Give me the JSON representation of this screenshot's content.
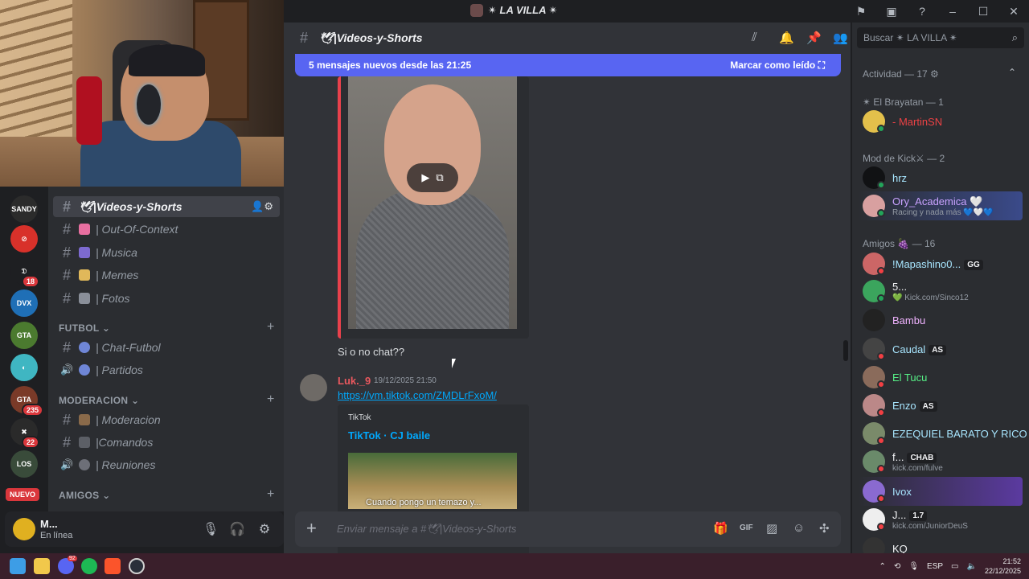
{
  "titlebar": {
    "server_name": "✴ LA VILLA ✴",
    "icons": [
      "inbox-flag-icon",
      "screen-icon",
      "help-icon",
      "minimize-icon",
      "maximize-icon",
      "close-icon"
    ],
    "btn_minimize": "–",
    "btn_maximize": "☐",
    "btn_close": "✕",
    "btn_flag": "⚑",
    "btn_help": "?"
  },
  "servers": [
    {
      "label": "SANDY",
      "color": "#2b2b2b",
      "badge": ""
    },
    {
      "label": "⊘",
      "color": "#d8312a",
      "badge": ""
    },
    {
      "label": "𝔇",
      "color": "#1e1f22",
      "badge": "18"
    },
    {
      "label": "DVX",
      "color": "#1f6fb6",
      "badge": ""
    },
    {
      "label": "GTA",
      "color": "#4b7a2f",
      "badge": ""
    },
    {
      "label": "◐",
      "color": "#3fb6c2",
      "badge": ""
    },
    {
      "label": "GTA",
      "color": "#7a3a28",
      "badge": "235"
    },
    {
      "label": "✖",
      "color": "#2a2a2a",
      "badge": "22"
    },
    {
      "label": "LOS",
      "color": "#394b3a",
      "badge": ""
    }
  ],
  "nuevo_label": "NUEVO",
  "channels": {
    "items": [
      {
        "name": "🕊|Videos-y-Shorts",
        "icon": "#",
        "active": true
      },
      {
        "name": "| Out-Of-Context",
        "icon": "#",
        "active": false
      },
      {
        "name": "| Musica",
        "icon": "#",
        "active": false
      },
      {
        "name": "| Memes",
        "icon": "#",
        "active": false
      },
      {
        "name": "| Fotos",
        "icon": "#",
        "active": false
      }
    ],
    "categories": [
      {
        "name": "FUTBOL",
        "items": [
          {
            "name": "| Chat-Futbol",
            "icon": "#"
          },
          {
            "name": "| Partidos",
            "icon": "🔊"
          }
        ]
      },
      {
        "name": "MODERACION",
        "items": [
          {
            "name": "| Moderacion",
            "icon": "#"
          },
          {
            "name": "|Comandos",
            "icon": "#"
          },
          {
            "name": "| Reuniones",
            "icon": "🔊"
          }
        ]
      },
      {
        "name": "AMIGOS",
        "items": []
      }
    ],
    "active_actions": [
      "add-member-icon",
      "gear-icon"
    ]
  },
  "user_panel": {
    "name": "M...",
    "status": "En línea",
    "buttons": [
      "microphone-icon",
      "headphones-icon",
      "settings-icon"
    ]
  },
  "chat": {
    "channel_name": "🕊|Videos-y-Shorts",
    "header_icons": [
      "threads-icon",
      "bell-icon",
      "pin-icon",
      "members-icon"
    ],
    "new_messages": "5 mensajes nuevos desde las 21:25",
    "mark_read": "Marcar como leído",
    "message1_text": "Si o no chat??",
    "message2": {
      "author": "Luk._9",
      "timestamp": "19/12/2025 21:50",
      "link": "https://vm.tiktok.com/ZMDLrFxoM/",
      "embed_provider": "TikTok",
      "embed_title": "TikTok · CJ baile",
      "embed_caption": "Cuando pongo un temazo y..."
    },
    "composer_placeholder": "Enviar mensaje a #🕊|Videos-y-Shorts",
    "composer_icons": [
      "gift-icon",
      "gif-icon",
      "sticker-icon",
      "emoji-icon",
      "apps-icon"
    ]
  },
  "members": {
    "search_placeholder": "Buscar ✴ LA VILLA ✴",
    "groups": [
      {
        "title": "Actividad — 17 ⚙",
        "members": []
      },
      {
        "title": "✴ El Brayatan — 1",
        "members": [
          {
            "name": "- MartinSN",
            "color": "#ed4245",
            "sub": "",
            "tag": "",
            "avatar": "#e3c04b",
            "status": "#23a55a"
          }
        ]
      },
      {
        "title": "Mod de Kick⚔ — 2",
        "members": [
          {
            "name": "hrz",
            "color": "#a8e6ff",
            "sub": "",
            "tag": "",
            "avatar": "#111214",
            "status": "#23a55a"
          },
          {
            "name": "Ory_Academica 🤍",
            "color": "#c9a2ff",
            "sub": "Racing y nada más 💙🤍💙",
            "tag": "",
            "avatar": "#d8a0a0",
            "status": "#23a55a"
          }
        ]
      },
      {
        "title": "Amigos 🍇 — 16",
        "members": [
          {
            "name": "!Mapashino0...",
            "color": "#a8e6ff",
            "sub": "",
            "tag": "GG",
            "avatar": "#c66",
            "status": "#f23f43"
          },
          {
            "name": "5...",
            "color": "#f2f3f5",
            "sub": "💚 Kick.com/Sinco12",
            "tag": "",
            "avatar": "#3ba55d",
            "status": "#23a55a"
          },
          {
            "name": "Bambu",
            "color": "#f0b3ff",
            "sub": "",
            "tag": "",
            "avatar": "#222",
            "status": ""
          },
          {
            "name": "Caudal",
            "color": "#a8e6ff",
            "sub": "",
            "tag": "AS",
            "avatar": "#444",
            "status": "#f23f43"
          },
          {
            "name": "El Tucu",
            "color": "#57f287",
            "sub": "",
            "tag": "",
            "avatar": "#8a6b5b",
            "status": "#f23f43"
          },
          {
            "name": "Enzo",
            "color": "#a8e6ff",
            "sub": "",
            "tag": "AS",
            "avatar": "#b88",
            "status": "#f23f43"
          },
          {
            "name": "EZEQUIEL BARATO Y RICO",
            "color": "#a8e6ff",
            "sub": "",
            "tag": "",
            "avatar": "#7a8a6a",
            "status": "#f23f43"
          },
          {
            "name": "f...",
            "color": "#f2f3f5",
            "sub": "kick.com/fulve",
            "tag": "CHAB",
            "avatar": "#6a8a6a",
            "status": "#f23f43"
          },
          {
            "name": "Ivox",
            "color": "#a8e6ff",
            "sub": "",
            "tag": "",
            "avatar": "#8a6ad0",
            "status": "#f23f43"
          },
          {
            "name": "J...",
            "color": "#f2f3f5",
            "sub": "kick.com/JuniorDeuS",
            "tag": "1.7",
            "avatar": "#eee",
            "status": "#f23f43"
          },
          {
            "name": "KQ",
            "color": "#f2f3f5",
            "sub": "",
            "tag": "",
            "avatar": "#333",
            "status": ""
          }
        ]
      }
    ]
  },
  "taskbar": {
    "apps": [
      "windows-start-icon",
      "file-explorer-icon",
      "discord-icon",
      "spotify-icon",
      "brave-icon",
      "steam-icon"
    ],
    "discord_badge": "92",
    "lang": "ESP",
    "time": "21:52",
    "date": "22/12/2025",
    "colors": {
      "accent": "#5865f2",
      "brand_red": "#da373c"
    }
  }
}
